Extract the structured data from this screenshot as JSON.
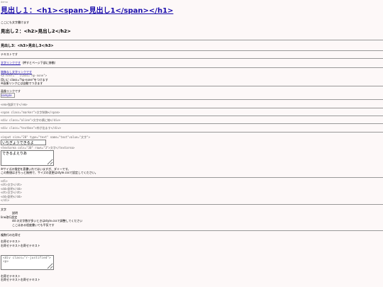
{
  "demo": "demo",
  "h1": "見出し１：<h1><span>見出し1</span></h1>",
  "p1": "ここにも文字書けます",
  "h2": "見出し２：<h2>見出し2</h2>",
  "h3": "見出し3：<h3>見出し3</h3>",
  "p2": "テキストです",
  "link1": "文字リンクです",
  "link1_suffix": "（押すとページ下部に移動）",
  "link2": "装飾なし文字リンクです",
  "code1": "<a href=\"\" class=\"hp-none\">",
  "note_a": "用いに class=\"hp-none\"をつけます",
  "note_b": "※画像リンクには自動でつきます",
  "img_link_label": "画像リンクです",
  "img_alt": "sample",
  "code_em": "<em>強調です</em>",
  "code_marker": "<span class=\"marker\">文字装飾</span>",
  "code_aline": "<div class=\"aline\">文字の横に線</div>",
  "code_textbox": "<div class=\"textbox\">枠が出ます</div>",
  "code_input": "<input size=\"20\" type=\"text\" name=\"text\"value=\"文字\">",
  "input_value": "いちぎょうできるよ",
  "code_textarea": "<textarea cols=\"30\" rows=\"3\">文字</textarea>",
  "textarea1_value": "できるよえりあ",
  "note_size_1": "※サイズの指定を直書いれてはいますが、ダミーです。",
  "note_size_2": "この数値はきちっと無視で、サイズの変更はstyle.cssで設定してください。",
  "dl_code": [
    "<dl>",
    "<dt>文字</dt>",
    "<dd>説明</dd>",
    "<dt>文字</dt>",
    "<dd>説明</dd>",
    "</dl>"
  ],
  "dl": {
    "dt1": "文字",
    "dd1": "説明",
    "dt2": "line改行設定",
    "dd2a": "dd の文字数が多いときはstyle.cssで調整してください",
    "dd2b": "ここはある程度書いても平気です"
  },
  "sec3": {
    "title": "複数行の右寄せ",
    "line1": "右寄せテキスト",
    "line2": "右寄せテキスト右寄せテキスト"
  },
  "textarea2_value": "<div class=\"r-justified\">\n<p>",
  "sec4": {
    "line1": "右寄せテキスト",
    "line2": "右寄せテキスト右寄せテキスト"
  }
}
